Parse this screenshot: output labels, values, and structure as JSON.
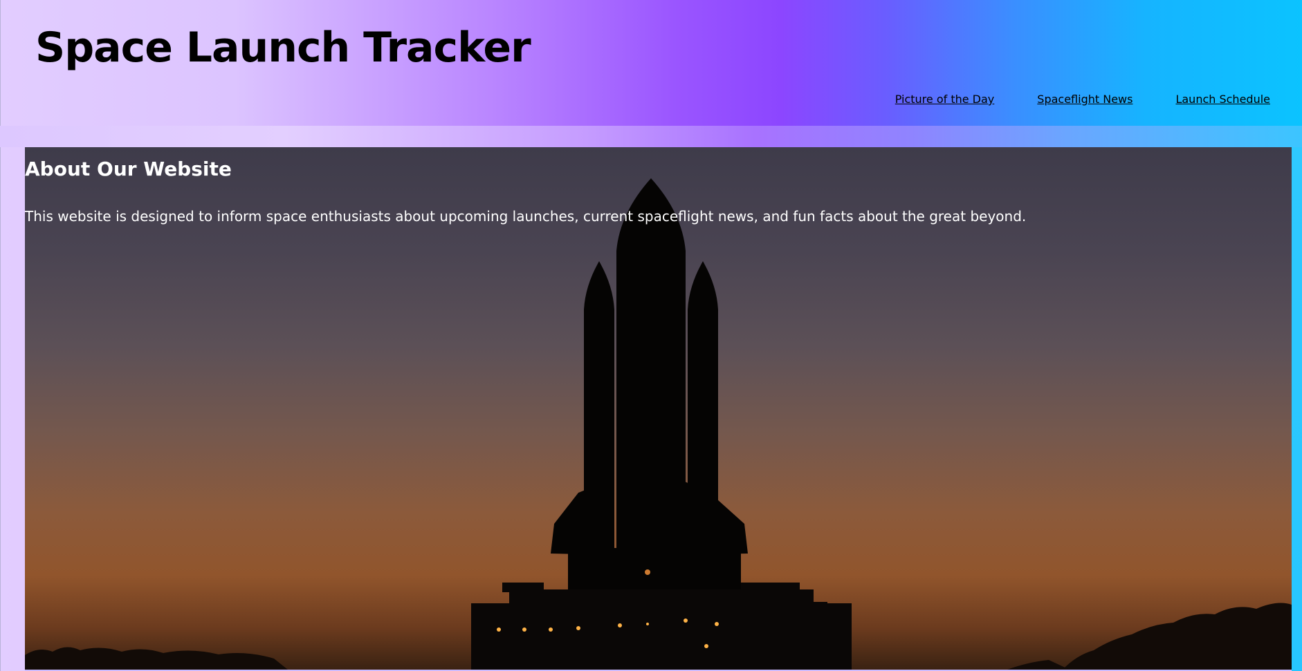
{
  "header": {
    "title": "Space Launch Tracker",
    "nav": [
      {
        "label": "Picture of the Day"
      },
      {
        "label": "Spaceflight News"
      },
      {
        "label": "Launch Schedule"
      }
    ]
  },
  "about": {
    "heading": "About Our Website",
    "text": "This website is designed to inform space enthusiasts about upcoming launches, current spaceflight news, and fun facts about the great beyond.",
    "background_image": "space-shuttle-silhouette-at-dusk"
  },
  "colors": {
    "gradient_start": "#e2cdff",
    "gradient_mid": "#8c46ff",
    "gradient_end": "#0bc3ff",
    "text_dark": "#000000",
    "text_light": "#ffffff"
  }
}
